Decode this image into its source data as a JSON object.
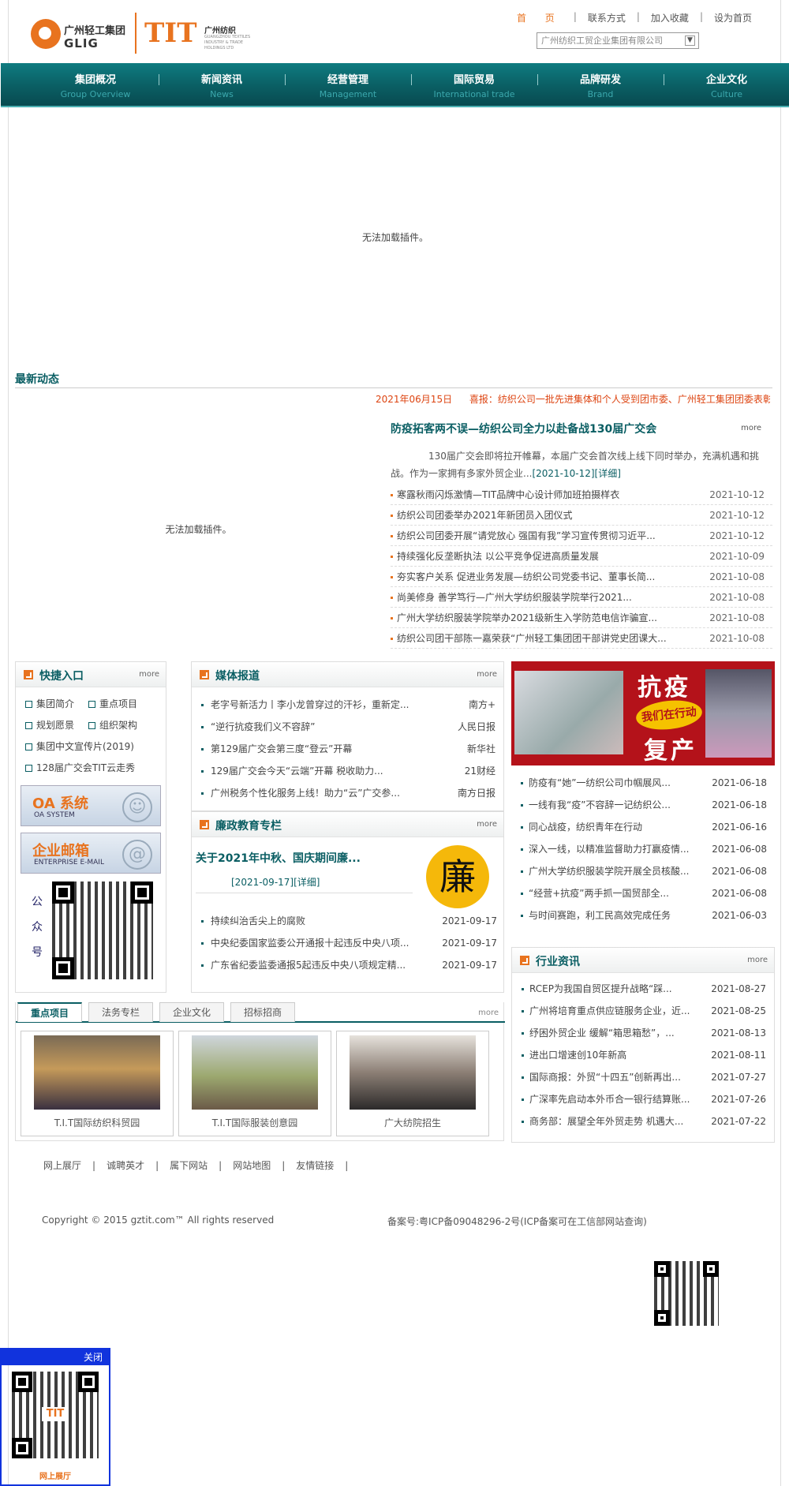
{
  "header": {
    "logo1": {
      "cn": "广州轻工集团",
      "en": "GLIG"
    },
    "logo2": {
      "big": "TIT",
      "cn": "广州纺织",
      "en": "GUANGZHOU TEXTILES INDUSTRY & TRADE HOLDINGS LTD"
    },
    "links": [
      "首 页",
      "联系方式",
      "加入收藏",
      "设为首页"
    ],
    "company_select": "广州纺织工贸企业集团有限公司"
  },
  "nav": [
    {
      "cn": "集团概况",
      "en": "Group Overview"
    },
    {
      "cn": "新闻资讯",
      "en": "News"
    },
    {
      "cn": "经营管理",
      "en": "Management"
    },
    {
      "cn": "国际贸易",
      "en": "International trade"
    },
    {
      "cn": "品牌研发",
      "en": "Brand"
    },
    {
      "cn": "企业文化",
      "en": "Culture"
    }
  ],
  "plugin_msg": "无法加载插件。",
  "latest": {
    "title": "最新动态",
    "ticker_date": "2021年06月15日",
    "ticker_text": "喜报：纺织公司一批先进集体和个人受到团市委、广州轻工集团团委表彰",
    "top_title": "防疫拓客两不误—纺织公司全力以赴备战130届广交会",
    "more": "more",
    "summary": "130届广交会即将拉开帷幕，本届广交会首次线上线下同时举办，充满机遇和挑战。作为一家拥有多家外贸企业...",
    "summary_link": "[2021-10-12][详细]",
    "items": [
      {
        "t": "寒露秋雨闪烁激情—TIT品牌中心设计师加班拍摄样衣",
        "d": "2021-10-12"
      },
      {
        "t": "纺织公司团委举办2021年新团员入团仪式",
        "d": "2021-10-12"
      },
      {
        "t": "纺织公司团委开展“请党放心 强国有我”学习宣传贯彻习近平...",
        "d": "2021-10-12"
      },
      {
        "t": "持续强化反垄断执法 以公平竞争促进高质量发展",
        "d": "2021-10-09"
      },
      {
        "t": "夯实客户关系 促进业务发展—纺织公司党委书记、董事长简...",
        "d": "2021-10-08"
      },
      {
        "t": "尚美修身 善学笃行—广州大学纺织服装学院举行2021...",
        "d": "2021-10-08"
      },
      {
        "t": "广州大学纺织服装学院举办2021级新生入学防范电信诈骗宣...",
        "d": "2021-10-08"
      },
      {
        "t": "纺织公司团干部陈一嘉荣获“广州轻工集团团干部讲党史团课大...",
        "d": "2021-10-08"
      }
    ]
  },
  "quick": {
    "title": "快捷入口",
    "more": "more",
    "items": [
      "集团简介",
      "重点项目",
      "规划愿景",
      "组织架构",
      "集团中文宣传片(2019)",
      "128届广交会TIT云走秀"
    ],
    "oa": {
      "a": "OA 系统",
      "b": "OA SYSTEM"
    },
    "mail": {
      "a": "企业邮箱",
      "b": "ENTERPRISE E-MAIL"
    },
    "gzh": "公众号"
  },
  "media": {
    "title": "媒体报道",
    "more": "more",
    "items": [
      {
        "t": "老字号新活力丨李小龙曾穿过的汗衫，重新定...",
        "s": "南方+"
      },
      {
        "t": "“逆行抗疫我们义不容辞”",
        "s": "人民日报"
      },
      {
        "t": "第129届广交会第三度“登云”开幕",
        "s": "新华社"
      },
      {
        "t": "129届广交会今天“云端”开幕 税收助力...",
        "s": "21财经"
      },
      {
        "t": "广州税务个性化服务上线！助力“云”广交参...",
        "s": "南方日报"
      }
    ]
  },
  "lian": {
    "title": "廉政教育专栏",
    "more": "more",
    "headline": "关于2021年中秋、国庆期间廉...",
    "headline_date": "[2021-09-17][详细]",
    "seal": "廉",
    "items": [
      {
        "t": "持续纠治舌尖上的腐败",
        "d": "2021-09-17"
      },
      {
        "t": "中央纪委国家监委公开通报十起违反中央八项...",
        "d": "2021-09-17"
      },
      {
        "t": "广东省纪委监委通报5起违反中央八项规定精...",
        "d": "2021-09-17"
      }
    ]
  },
  "banner": {
    "k1": "抗疫",
    "k2": "我们在行动",
    "k3": "复产"
  },
  "right_news": [
    {
      "t": "防疫有“她”一纺织公司巾帼展风...",
      "d": "2021-06-18"
    },
    {
      "t": "一线有我“疫”不容辞一记纺织公...",
      "d": "2021-06-18"
    },
    {
      "t": "同心战疫，纺织青年在行动",
      "d": "2021-06-16"
    },
    {
      "t": "深入一线，以精准监督助力打赢疫情...",
      "d": "2021-06-08"
    },
    {
      "t": "广州大学纺织服装学院开展全员核酸...",
      "d": "2021-06-08"
    },
    {
      "t": "“经营+抗疫”两手抓一国贸部全...",
      "d": "2021-06-08"
    },
    {
      "t": "与时间赛跑，利工民高效完成任务",
      "d": "2021-06-03"
    }
  ],
  "industry": {
    "title": "行业资讯",
    "more": "more",
    "items": [
      {
        "t": "RCEP为我国自贸区提升战略“踩...",
        "d": "2021-08-27"
      },
      {
        "t": "广州将培育重点供应链服务企业，近...",
        "d": "2021-08-25"
      },
      {
        "t": "纾困外贸企业 缓解“箱思箱愁”，...",
        "d": "2021-08-13"
      },
      {
        "t": "进出口增速创10年新高",
        "d": "2021-08-11"
      },
      {
        "t": "国际商报：外贸“十四五”创新再出...",
        "d": "2021-07-27"
      },
      {
        "t": "广深率先启动本外币合一银行结算账...",
        "d": "2021-07-26"
      },
      {
        "t": "商务部：展望全年外贸走势 机遇大...",
        "d": "2021-07-22"
      }
    ]
  },
  "tabs": {
    "labels": [
      "重点项目",
      "法务专栏",
      "企业文化",
      "招标招商"
    ],
    "more": "more",
    "projects": [
      "T.I.T国际纺织科贸园",
      "T.I.T国际服装创意园",
      "广大纺院招生"
    ]
  },
  "footer": {
    "links": [
      "网上展厅",
      "诚聘英才",
      "属下网站",
      "网站地图",
      "友情链接"
    ],
    "copyright": "Copyright © 2015 gztit.com™ All rights reserved",
    "beian": "备案号:粤ICP备09048296-2号(ICP备案可在工信部网站查询)"
  },
  "float": {
    "close": "关闭",
    "label": "网上展厅",
    "logo": "TIT"
  }
}
